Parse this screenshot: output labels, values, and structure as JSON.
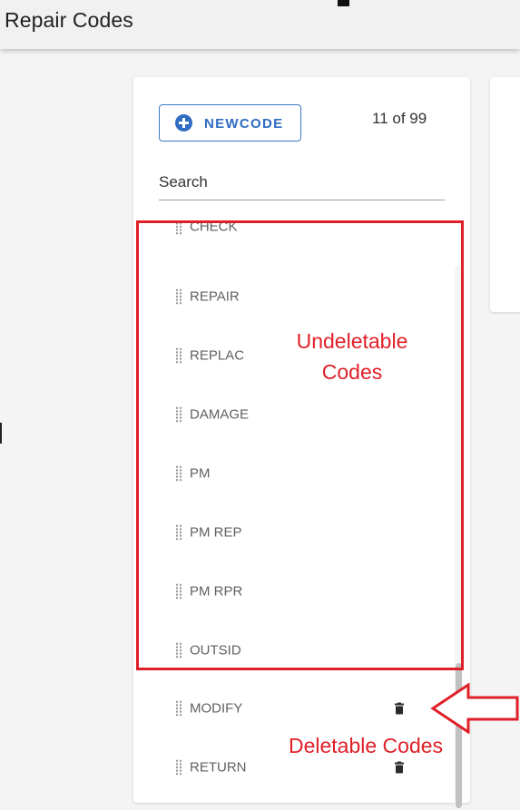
{
  "header": {
    "title": "Repair Codes"
  },
  "panel": {
    "new_code_label": "NEWCODE",
    "count": "11 of 99",
    "search_label": "Search"
  },
  "codes": [
    {
      "label": "CHECK",
      "deletable": false
    },
    {
      "label": "REPAIR",
      "deletable": false
    },
    {
      "label": "REPLAC",
      "deletable": false
    },
    {
      "label": "DAMAGE",
      "deletable": false
    },
    {
      "label": "PM",
      "deletable": false
    },
    {
      "label": "PM REP",
      "deletable": false
    },
    {
      "label": "PM RPR",
      "deletable": false
    },
    {
      "label": "OUTSID",
      "deletable": false
    },
    {
      "label": "MODIFY",
      "deletable": true
    },
    {
      "label": "RETURN",
      "deletable": true
    }
  ],
  "annotations": {
    "undeletable_line1": "Undeletable",
    "undeletable_line2": "Codes",
    "deletable": "Deletable Codes",
    "color": "#e02028"
  },
  "colors": {
    "accent": "#2f6cc2"
  },
  "icons": {
    "new_code": "plus-circle-icon",
    "row_handle": "drag-handle-icon",
    "delete": "trash-icon"
  }
}
